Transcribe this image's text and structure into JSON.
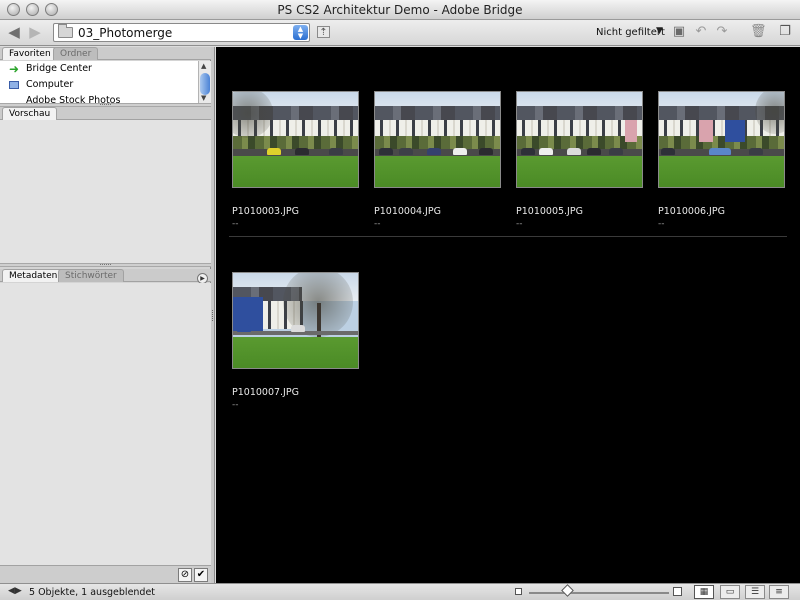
{
  "window": {
    "title": "PS CS2 Architektur Demo - Adobe Bridge"
  },
  "toolbar": {
    "path": "03_Photomerge",
    "filter_label": "Nicht gefiltert"
  },
  "left_panel": {
    "top_tabs": [
      "Favoriten",
      "Ordner"
    ],
    "favorites": [
      "Bridge Center",
      "Computer",
      "Adobe Stock Photos"
    ],
    "preview_tab": "Vorschau",
    "bottom_tabs": [
      "Metadaten",
      "Stichwörter"
    ]
  },
  "thumbnails": [
    {
      "filename": "P1010003.JPG",
      "rating": "--"
    },
    {
      "filename": "P1010004.JPG",
      "rating": "--"
    },
    {
      "filename": "P1010005.JPG",
      "rating": "--"
    },
    {
      "filename": "P1010006.JPG",
      "rating": "--"
    },
    {
      "filename": "P1010007.JPG",
      "rating": "--"
    }
  ],
  "status": {
    "text": "5 Objekte, 1 ausgeblendet"
  },
  "colors": {
    "content_bg": "#000000",
    "lawn": "#4f9228",
    "accent_blue": "#2f4f9e"
  }
}
